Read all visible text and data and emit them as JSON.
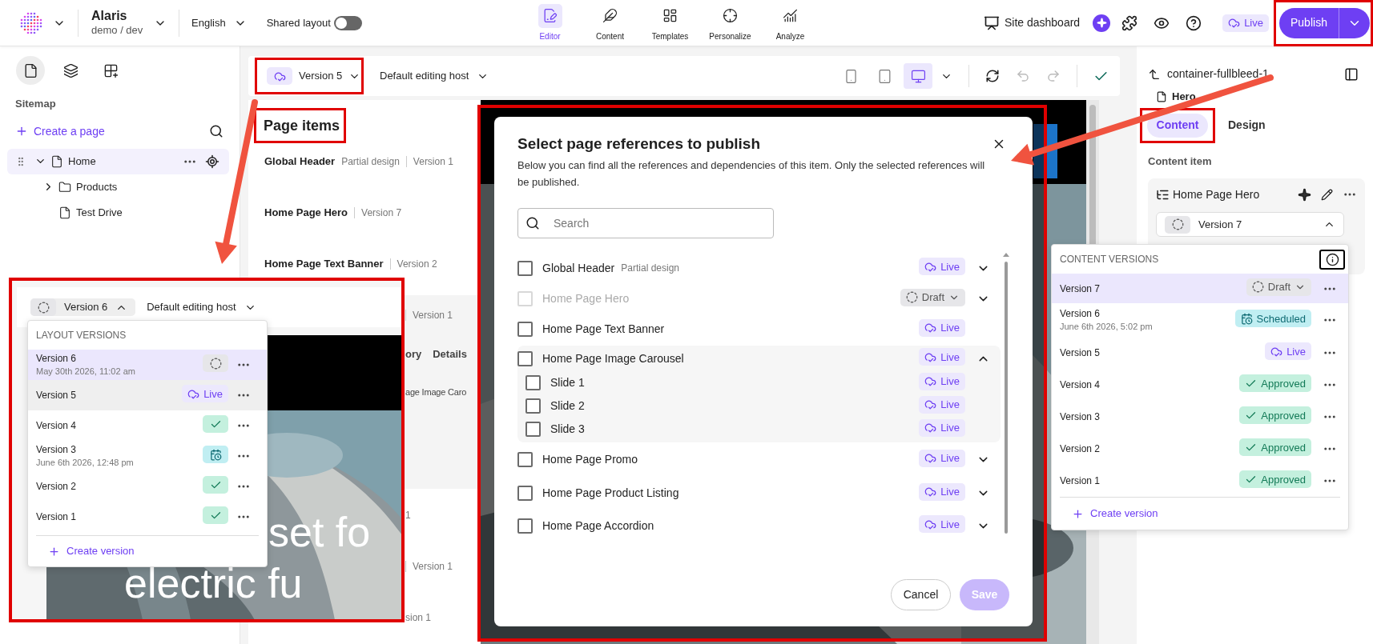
{
  "header": {
    "org_name": "Alaris",
    "environment": "demo / dev",
    "language": "English",
    "shared_layout": {
      "label": "Shared layout",
      "on": false
    },
    "nav": [
      {
        "kind": "editor",
        "label": "Editor",
        "selected": true
      },
      {
        "kind": "content",
        "label": "Content",
        "selected": false
      },
      {
        "kind": "templates",
        "label": "Templates",
        "selected": false
      },
      {
        "kind": "personalize",
        "label": "Personalize",
        "selected": false
      },
      {
        "kind": "analyze",
        "label": "Analyze",
        "selected": false
      }
    ],
    "site_dashboard": "Site dashboard",
    "status": {
      "kind": "live",
      "label": "Live"
    },
    "publish": "Publish"
  },
  "sidebar": {
    "tabs": [
      {
        "kind": "pages",
        "selected": true
      },
      {
        "kind": "layers",
        "selected": false
      },
      {
        "kind": "components",
        "selected": false
      }
    ],
    "title": "Sitemap",
    "create_page": "Create a page",
    "tree": [
      {
        "label": "Home",
        "kind": "page",
        "selected": true,
        "expanded": true,
        "children": [
          {
            "label": "Products",
            "kind": "folder",
            "selected": false,
            "expanded": false
          },
          {
            "label": "Test Drive",
            "kind": "page",
            "selected": false
          }
        ]
      }
    ]
  },
  "toolbar": {
    "version": {
      "label": "Version 5",
      "status": {
        "kind": "live"
      }
    },
    "host": "Default editing host",
    "devices": [
      {
        "kind": "phone",
        "selected": false
      },
      {
        "kind": "tablet",
        "selected": false
      },
      {
        "kind": "desktop",
        "selected": true
      }
    ]
  },
  "page_items": {
    "title": "Page items",
    "items": [
      {
        "name": "Global Header",
        "tag": "Partial design",
        "version": "Version 1"
      },
      {
        "name": "Home Page Hero",
        "version": "Version 7"
      },
      {
        "name": "Home Page Text Banner",
        "version": "Version 2"
      }
    ],
    "expanded_item": {
      "version": "Version 1",
      "tabs": [
        "ory",
        "Details"
      ],
      "text": "age Image Caro"
    },
    "more_items": [
      {
        "version": "1",
        "divider": false
      },
      {
        "version": "Version 1",
        "divider": true
      },
      {
        "version": "sion 1",
        "divider": false
      }
    ]
  },
  "layout_versions_inset": {
    "version": {
      "label": "Version 6",
      "status": {
        "kind": "draft"
      }
    },
    "expanded": true,
    "host": "Default editing host",
    "title": "LAYOUT VERSIONS",
    "versions": [
      {
        "label": "Version 6",
        "date": "May 30th 2026, 11:02 am",
        "status": {
          "kind": "draft"
        },
        "selected": true,
        "hovered": false
      },
      {
        "label": "Version 5",
        "status": {
          "kind": "live",
          "label": "Live"
        },
        "selected": false,
        "hovered": true
      },
      {
        "label": "Version 4",
        "status": {
          "kind": "approved"
        },
        "selected": false,
        "hovered": false
      },
      {
        "label": "Version 3",
        "date": "June 6th 2026, 12:48 pm",
        "status": {
          "kind": "scheduled"
        },
        "selected": false,
        "hovered": false
      },
      {
        "label": "Version 2",
        "status": {
          "kind": "approved"
        },
        "selected": false,
        "hovered": false
      },
      {
        "label": "Version 1",
        "status": {
          "kind": "approved"
        },
        "selected": false,
        "hovered": false
      }
    ],
    "create": "Create version",
    "hero_text": [
      "set fo",
      "electric fu"
    ]
  },
  "publish_dialog": {
    "title": "Select page references to publish",
    "description": "Below you can find all the references and dependencies of this item. Only the selected references will be published.",
    "search_placeholder": "Search",
    "references": [
      {
        "name": "Global Header",
        "tag": "Partial design",
        "checked": false,
        "disabled": false,
        "status": {
          "kind": "live",
          "label": "Live"
        },
        "expanded": false
      },
      {
        "name": "Home Page Hero",
        "checked": false,
        "disabled": true,
        "status": {
          "kind": "draft",
          "label": "Draft",
          "dropdown": true
        },
        "expanded": false
      },
      {
        "name": "Home Page Text Banner",
        "checked": false,
        "disabled": false,
        "status": {
          "kind": "live",
          "label": "Live"
        }
      },
      {
        "name": "Home Page Image Carousel",
        "checked": false,
        "disabled": false,
        "status": {
          "kind": "live",
          "label": "Live"
        },
        "expanded": true,
        "children": [
          {
            "name": "Slide 1",
            "checked": false,
            "disabled": false,
            "status": {
              "kind": "live",
              "label": "Live"
            }
          },
          {
            "name": "Slide 2",
            "checked": false,
            "disabled": false,
            "status": {
              "kind": "live",
              "label": "Live"
            }
          },
          {
            "name": "Slide 3",
            "checked": false,
            "disabled": false,
            "status": {
              "kind": "live",
              "label": "Live"
            }
          }
        ]
      },
      {
        "name": "Home Page Promo",
        "checked": false,
        "disabled": false,
        "status": {
          "kind": "live",
          "label": "Live"
        },
        "expanded": false
      },
      {
        "name": "Home Page Product Listing",
        "checked": false,
        "disabled": false,
        "status": {
          "kind": "live",
          "label": "Live"
        },
        "expanded": false
      },
      {
        "name": "Home Page Accordion",
        "checked": false,
        "disabled": false,
        "status": {
          "kind": "live",
          "label": "Live"
        },
        "expanded": false
      }
    ],
    "cancel": "Cancel",
    "save": "Save",
    "save_disabled": true
  },
  "right_panel": {
    "breadcrumb": "container-fullbleed-1",
    "component": "Hero",
    "tabs": [
      {
        "label": "Content",
        "selected": true
      },
      {
        "label": "Design",
        "selected": false
      }
    ],
    "section": "Content item",
    "content_item": {
      "name": "Home Page Hero",
      "version": "Version 7",
      "status": {
        "kind": "draft"
      },
      "expanded": true
    },
    "versions_popup": {
      "title": "CONTENT VERSIONS",
      "versions": [
        {
          "label": "Version 7",
          "status": {
            "kind": "draft",
            "label": "Draft",
            "dropdown": true
          },
          "selected": true
        },
        {
          "label": "Version 6",
          "date": "June 6th 2026, 5:02 pm",
          "status": {
            "kind": "scheduled",
            "label": "Scheduled"
          },
          "selected": false
        },
        {
          "label": "Version 5",
          "status": {
            "kind": "live",
            "label": "Live"
          },
          "selected": false
        },
        {
          "label": "Version 4",
          "status": {
            "kind": "approved",
            "label": "Approved"
          },
          "selected": false
        },
        {
          "label": "Version 3",
          "status": {
            "kind": "approved",
            "label": "Approved"
          },
          "selected": false
        },
        {
          "label": "Version 2",
          "status": {
            "kind": "approved",
            "label": "Approved"
          },
          "selected": false
        },
        {
          "label": "Version 1",
          "status": {
            "kind": "approved",
            "label": "Approved"
          },
          "selected": false
        }
      ],
      "create": "Create version"
    }
  }
}
